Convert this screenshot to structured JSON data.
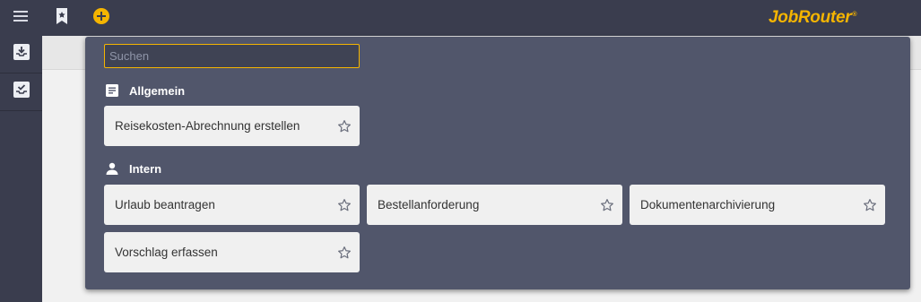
{
  "header": {
    "logo_text": "JobRouter",
    "logo_mark": "®",
    "accent_color": "#f5b500",
    "icons": [
      "menu-icon",
      "bookmark-star-icon",
      "add-circle-icon"
    ]
  },
  "sidebar": {
    "items": [
      {
        "icon": "inbox-download-icon"
      },
      {
        "icon": "inbox-check-icon"
      }
    ]
  },
  "start_panel": {
    "search": {
      "placeholder": "Suchen",
      "value": ""
    },
    "sections": [
      {
        "title": "Allgemein",
        "icon": "document-list-icon",
        "items": [
          {
            "label": "Reisekosten-Abrechnung erstellen",
            "favorite": false
          }
        ]
      },
      {
        "title": "Intern",
        "icon": "person-icon",
        "items": [
          {
            "label": "Urlaub beantragen",
            "favorite": false
          },
          {
            "label": "Bestellanforderung",
            "favorite": false
          },
          {
            "label": "Dokumentenarchivierung",
            "favorite": false
          },
          {
            "label": "Vorschlag erfassen",
            "favorite": false
          }
        ]
      }
    ]
  }
}
